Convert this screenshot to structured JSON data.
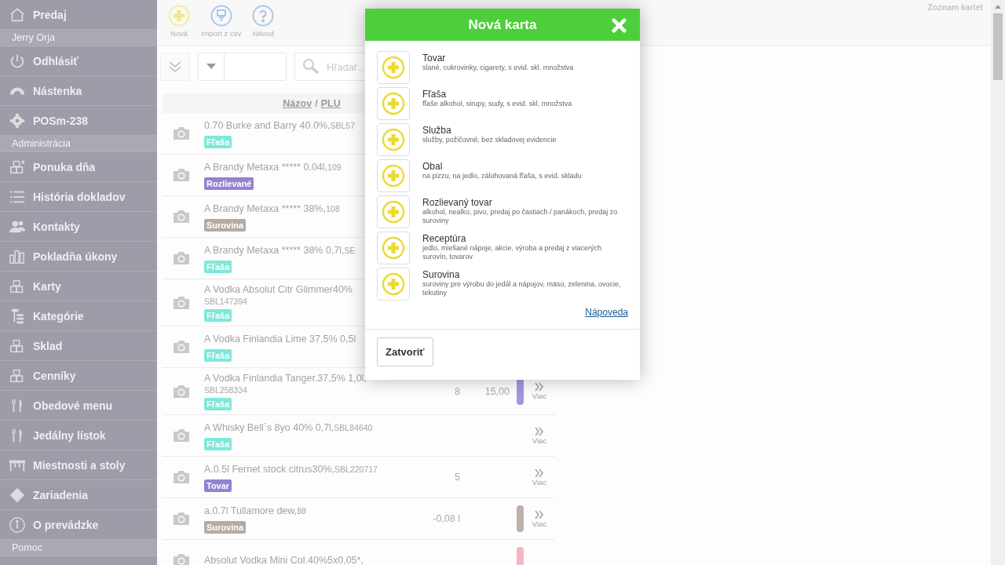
{
  "sidebar": {
    "entries": [
      {
        "kind": "item",
        "label": "Predaj"
      },
      {
        "kind": "header",
        "label": "Jerry Orja"
      },
      {
        "kind": "item",
        "label": "Odhlásiť"
      },
      {
        "kind": "item",
        "label": "Nástenka"
      },
      {
        "kind": "item",
        "label": "POSm-238"
      },
      {
        "kind": "header",
        "label": "Administrácia"
      },
      {
        "kind": "item",
        "label": "Ponuka dňa"
      },
      {
        "kind": "item",
        "label": "História dokladov"
      },
      {
        "kind": "item",
        "label": "Kontakty"
      },
      {
        "kind": "item",
        "label": "Pokladňa úkony"
      },
      {
        "kind": "item",
        "label": "Karty"
      },
      {
        "kind": "item",
        "label": "Kategórie"
      },
      {
        "kind": "item",
        "label": "Sklad"
      },
      {
        "kind": "item",
        "label": "Cenníky"
      },
      {
        "kind": "item",
        "label": "Obedové menu"
      },
      {
        "kind": "item",
        "label": "Jedálny lístok"
      },
      {
        "kind": "item",
        "label": "Miestnosti a stoly"
      },
      {
        "kind": "item",
        "label": "Zariadenia"
      },
      {
        "kind": "item",
        "label": "O prevádzke"
      },
      {
        "kind": "header",
        "label": "Pomoc"
      }
    ]
  },
  "toolbar": {
    "buttons": [
      {
        "kind": "add",
        "label": "Nová"
      },
      {
        "kind": "import",
        "label": "Import z csv"
      },
      {
        "kind": "help",
        "label": "Návod"
      }
    ],
    "page_title": "Zoznam kariet"
  },
  "filters": {
    "search": {
      "placeholder": "Hľadať.."
    }
  },
  "table": {
    "header": {
      "name": "Názov",
      "separator": "/",
      "plu": "PLU"
    },
    "rows": [
      {
        "kind": "inline",
        "name": "0.70 Burke and Barry 40.0%,",
        "plu": "SBL57",
        "tag": {
          "label": "Fľaša",
          "color": "#7ee8d9"
        }
      },
      {
        "kind": "inline",
        "name": "A Brandy Metaxa ***** 0.04l,",
        "plu": "109",
        "tag": {
          "label": "Rozlievané",
          "color": "#9382cf"
        }
      },
      {
        "kind": "inline",
        "name": "A Brandy Metaxa ***** 38%,",
        "plu": "108",
        "tag": {
          "label": "Surovina",
          "color": "#b8aaa0"
        }
      },
      {
        "kind": "inline",
        "name": "A Brandy Metaxa ***** 38% 0,7l,",
        "plu": "SE",
        "tag": {
          "label": "Fľaša",
          "color": "#7ee8d9"
        }
      },
      {
        "kind": "stacked",
        "name": "A Vodka Absolut Citr Glimmer40%",
        "plu": "SBL147394",
        "tag": {
          "label": "Fľaša",
          "color": "#7ee8d9"
        }
      },
      {
        "name": "A Vodka Finlandia Lime 37,5% 0,5l",
        "tag": {
          "label": "Fľaša",
          "color": "#7ee8d9"
        }
      },
      {
        "kind": "stacked",
        "name": "A Vodka Finlandia Tanger.37,5% 1,0l,",
        "plu": "SBL258334",
        "tag": {
          "label": "Fľaša",
          "color": "#7ee8d9"
        },
        "quantity": "8",
        "price": "15,00",
        "color": "#a596e0",
        "more": "Viac"
      },
      {
        "kind": "inline",
        "name": "A Whisky Bell´s 8yo 40% 0,7l,",
        "plu": "SBL84640",
        "tag": {
          "label": "Fľaša",
          "color": "#7ee8d9"
        },
        "more": "Viac"
      },
      {
        "kind": "inline",
        "name": "A.0.5l Fernet stock citrus30%,",
        "plu": "SBL220717",
        "tag": {
          "label": "Tovar",
          "color": "#9382cf"
        },
        "quantity": "5",
        "more": "Viac"
      },
      {
        "kind": "inline",
        "name": "a.0.7l Tullamore dew,",
        "plu": "88",
        "tag": {
          "label": "Surovina",
          "color": "#b8aaa0"
        },
        "quantity": "-0,08 l",
        "color": "#bfb1a8",
        "more": "Viac"
      },
      {
        "name": "Absolut Vodka Mini Col.40%5x0,05*,",
        "color": "#f2b8c4"
      }
    ]
  },
  "modal": {
    "title": "Nová karta",
    "options": [
      {
        "title": "Tovar",
        "description": "slané, cukrovinky, cigarety, s evid. skl. množstva"
      },
      {
        "title": "Fľaša",
        "description": "fľaše alkohol, sirupy, sudy, s evid. skl. množstva"
      },
      {
        "title": "Služba",
        "description": "služby, požičovné, bez skladovej evidencie"
      },
      {
        "title": "Obal",
        "description": "na pizzu, na jedlo, zálohovaná fľaša, s evid. skladu"
      },
      {
        "title": "Rozlievaný tovar",
        "description": "alkohol, nealko, pivo, predaj po častiach / panákoch, predaj zo suroviny"
      },
      {
        "title": "Receptúra",
        "description": "jedlo, miešané nápoje, akcie, výroba a predaj z viacerých surovín, tovarov"
      },
      {
        "title": "Surovina",
        "description": "suroviny pre výrobu do jedál a nápojov, mäso, zelenina, ovocie, tekutiny"
      }
    ],
    "help_link": "Nápoveda",
    "close_button": "Zatvoriť"
  }
}
